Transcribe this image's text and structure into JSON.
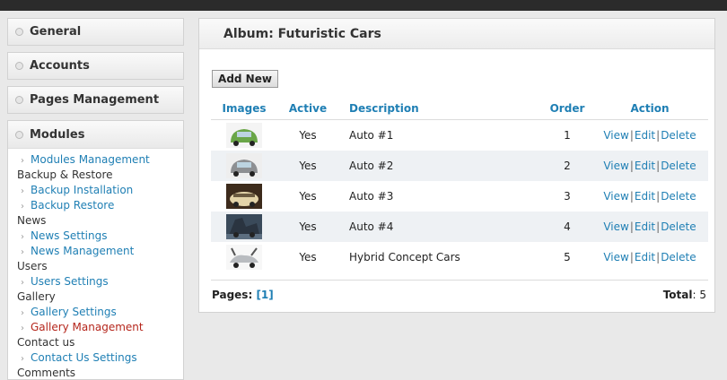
{
  "sidebar": {
    "sections": [
      {
        "label": "General"
      },
      {
        "label": "Accounts"
      },
      {
        "label": "Pages Management"
      }
    ],
    "modules": {
      "label": "Modules",
      "items": [
        {
          "type": "link",
          "label": "Modules Management"
        },
        {
          "type": "cat",
          "label": "Backup & Restore"
        },
        {
          "type": "link",
          "label": "Backup Installation"
        },
        {
          "type": "link",
          "label": "Backup Restore"
        },
        {
          "type": "cat",
          "label": "News"
        },
        {
          "type": "link",
          "label": "News Settings"
        },
        {
          "type": "link",
          "label": "News Management"
        },
        {
          "type": "cat",
          "label": "Users"
        },
        {
          "type": "link",
          "label": "Users Settings"
        },
        {
          "type": "cat",
          "label": "Gallery"
        },
        {
          "type": "link",
          "label": "Gallery Settings"
        },
        {
          "type": "link",
          "label": "Gallery Management",
          "active": true
        },
        {
          "type": "cat",
          "label": "Contact us"
        },
        {
          "type": "link",
          "label": "Contact Us Settings"
        },
        {
          "type": "cat",
          "label": "Comments"
        }
      ]
    }
  },
  "main": {
    "title": "Album: Futuristic Cars",
    "add_label": "Add New",
    "columns": {
      "images": "Images",
      "active": "Active",
      "description": "Description",
      "order": "Order",
      "action": "Action"
    },
    "rows": [
      {
        "active": "Yes",
        "description": "Auto #1",
        "order": "1",
        "thumb": "car-thumbnail-1"
      },
      {
        "active": "Yes",
        "description": "Auto #2",
        "order": "2",
        "thumb": "car-thumbnail-2"
      },
      {
        "active": "Yes",
        "description": "Auto #3",
        "order": "3",
        "thumb": "car-thumbnail-3"
      },
      {
        "active": "Yes",
        "description": "Auto #4",
        "order": "4",
        "thumb": "car-thumbnail-4"
      },
      {
        "active": "Yes",
        "description": "Hybrid Concept Cars",
        "order": "5",
        "thumb": "car-thumbnail-5"
      }
    ],
    "actions": {
      "view": "View",
      "edit": "Edit",
      "delete": "Delete",
      "separator": "|"
    },
    "pages_label": "Pages:",
    "current_page": "[1]",
    "total_label": "Total",
    "total_colon": ":",
    "total_value": "5"
  },
  "colors": {
    "link": "#1f7fb4",
    "active_link": "#b5261c",
    "top_bar": "#2b2b2b"
  }
}
